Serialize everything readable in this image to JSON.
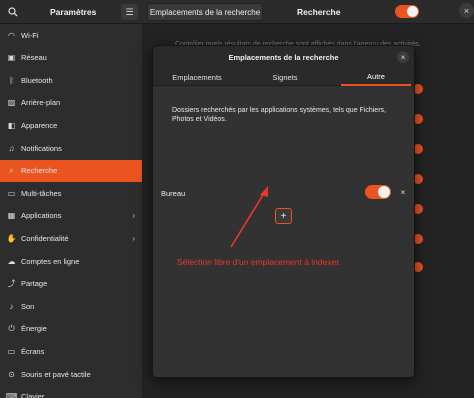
{
  "header": {
    "app_title": "Paramètres",
    "panel_button_label": "Emplacements de la recherche",
    "section_title": "Recherche",
    "search_icon": "search-icon",
    "menu_icon": "hamburger-menu-icon",
    "close_icon": "close-icon",
    "toggle_state": "on"
  },
  "sidebar": {
    "items": [
      {
        "label": "Wi-Fi",
        "icon": "wifi-icon",
        "glyph": "◠",
        "chevron": false,
        "active": false
      },
      {
        "label": "Réseau",
        "icon": "network-icon",
        "glyph": "▣",
        "chevron": false,
        "active": false
      },
      {
        "label": "Bluetooth",
        "icon": "bluetooth-icon",
        "glyph": "ᛒ",
        "chevron": false,
        "active": false
      },
      {
        "label": "Arrière-plan",
        "icon": "background-icon",
        "glyph": "▨",
        "chevron": false,
        "active": false
      },
      {
        "label": "Apparence",
        "icon": "appearance-icon",
        "glyph": "◧",
        "chevron": false,
        "active": false
      },
      {
        "label": "Notifications",
        "icon": "notifications-icon",
        "glyph": "♫",
        "chevron": false,
        "active": false
      },
      {
        "label": "Recherche",
        "icon": "search-icon",
        "glyph": "⌕",
        "chevron": false,
        "active": true
      },
      {
        "label": "Multi-tâches",
        "icon": "multitasking-icon",
        "glyph": "▭",
        "chevron": false,
        "active": false
      },
      {
        "label": "Applications",
        "icon": "applications-icon",
        "glyph": "▦",
        "chevron": true,
        "active": false
      },
      {
        "label": "Confidentialité",
        "icon": "privacy-icon",
        "glyph": "✋",
        "chevron": true,
        "active": false
      },
      {
        "label": "Comptes en ligne",
        "icon": "online-accounts-icon",
        "glyph": "☁",
        "chevron": false,
        "active": false
      },
      {
        "label": "Partage",
        "icon": "sharing-icon",
        "glyph": "⤴",
        "chevron": false,
        "active": false
      },
      {
        "label": "Son",
        "icon": "sound-icon",
        "glyph": "♪",
        "chevron": false,
        "active": false
      },
      {
        "label": "Énergie",
        "icon": "power-icon",
        "glyph": "⏻",
        "chevron": false,
        "active": false
      },
      {
        "label": "Écrans",
        "icon": "displays-icon",
        "glyph": "▭",
        "chevron": false,
        "active": false
      },
      {
        "label": "Souris et pavé tactile",
        "icon": "mouse-icon",
        "glyph": "⊙",
        "chevron": false,
        "active": false
      },
      {
        "label": "Clavier",
        "icon": "keyboard-icon",
        "glyph": "⌨",
        "chevron": false,
        "active": false
      }
    ]
  },
  "background": {
    "description": "Contrôler quels résultats de recherche sont affichés dans l'aperçu des activités. L'ordre des lignes"
  },
  "dialog": {
    "title": "Emplacements de la recherche",
    "close_icon": "close-icon",
    "tabs": [
      {
        "label": "Emplacements",
        "active": false
      },
      {
        "label": "Signets",
        "active": false
      },
      {
        "label": "Autre",
        "active": true
      }
    ],
    "description": "Dossiers recherchés par les applications systèmes, tels que Fichiers, Photos et Vidéos.",
    "locations": [
      {
        "label": "Bureau",
        "enabled": true,
        "remove_icon": "remove-icon"
      }
    ],
    "add_button_glyph": "+",
    "add_icon": "add-icon"
  },
  "annotation": {
    "text": "Sélection libre d'un emplacement à indexer.",
    "color": "#e8382a"
  },
  "colors": {
    "accent": "#e95420",
    "sidebar_bg": "#2d2d2d",
    "dialog_bg": "#323232"
  }
}
